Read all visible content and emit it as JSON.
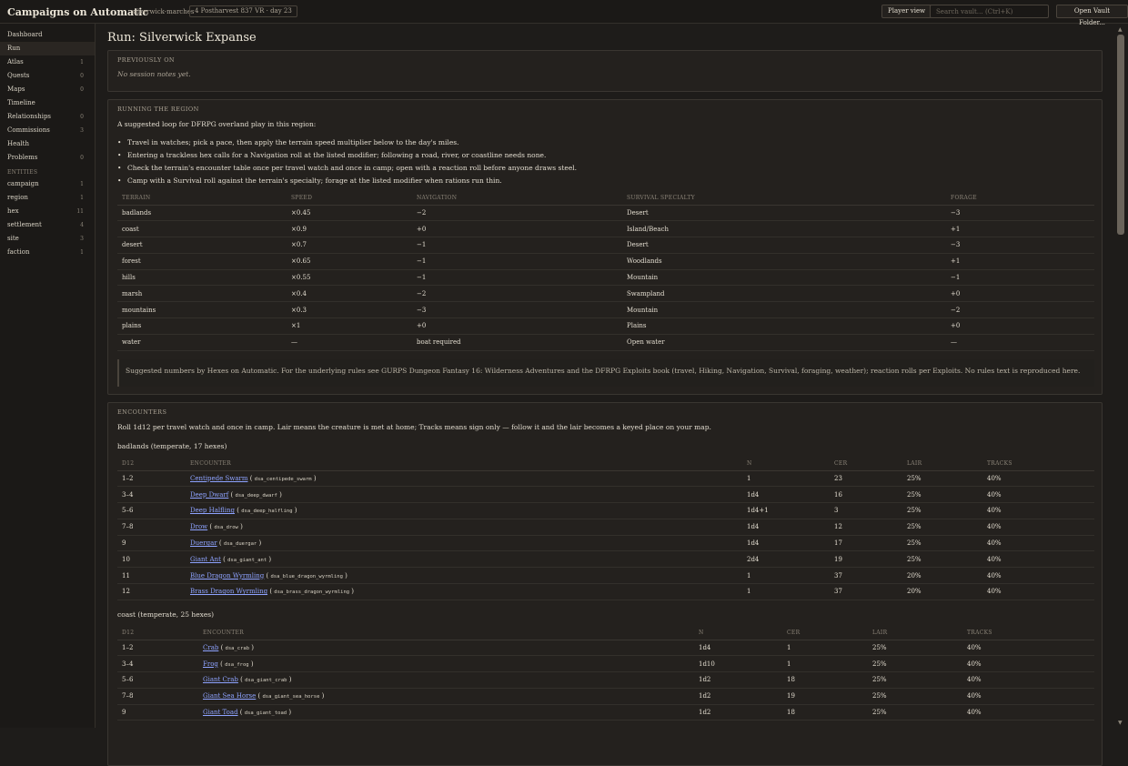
{
  "app": {
    "title": "Campaigns on Automatic",
    "campaign": "silverwick-marches",
    "date": "4 Postharvest 837 VR · day 23",
    "player_view": "Player view",
    "search_placeholder": "Search vault… (Ctrl+K)",
    "open_vault": "Open Vault Folder..."
  },
  "sidebar": {
    "items": [
      {
        "label": "Dashboard",
        "count": ""
      },
      {
        "label": "Run",
        "count": ""
      },
      {
        "label": "Atlas",
        "count": "1"
      },
      {
        "label": "Quests",
        "count": "0"
      },
      {
        "label": "Maps",
        "count": "0"
      },
      {
        "label": "Timeline",
        "count": ""
      },
      {
        "label": "Relationships",
        "count": "0"
      },
      {
        "label": "Commissions",
        "count": "3"
      },
      {
        "label": "Health",
        "count": ""
      },
      {
        "label": "Problems",
        "count": "0"
      }
    ],
    "entities_header": "ENTITIES",
    "entities": [
      {
        "label": "campaign",
        "count": "1"
      },
      {
        "label": "region",
        "count": "1"
      },
      {
        "label": "hex",
        "count": "11"
      },
      {
        "label": "settlement",
        "count": "4"
      },
      {
        "label": "site",
        "count": "3"
      },
      {
        "label": "faction",
        "count": "1"
      }
    ]
  },
  "page": {
    "title": "Run: Silverwick Expanse"
  },
  "previously": {
    "label": "PREVIOUSLY ON",
    "text": "No session notes yet."
  },
  "running": {
    "label": "RUNNING THE REGION",
    "intro": "A suggested loop for DFRPG overland play in this region:",
    "bullets": [
      "Travel in watches; pick a pace, then apply the terrain speed multiplier below to the day's miles.",
      "Entering a trackless hex calls for a Navigation roll at the listed modifier; following a road, river, or coastline needs none.",
      "Check the terrain's encounter table once per travel watch and once in camp; open with a reaction roll before anyone draws steel.",
      "Camp with a Survival roll against the terrain's specialty; forage at the listed modifier when rations run thin."
    ],
    "headers": [
      "TERRAIN",
      "SPEED",
      "NAVIGATION",
      "SURVIVAL SPECIALTY",
      "FORAGE"
    ],
    "rows": [
      [
        "badlands",
        "×0.45",
        "−2",
        "Desert",
        "−3"
      ],
      [
        "coast",
        "×0.9",
        "+0",
        "Island/Beach",
        "+1"
      ],
      [
        "desert",
        "×0.7",
        "−1",
        "Desert",
        "−3"
      ],
      [
        "forest",
        "×0.65",
        "−1",
        "Woodlands",
        "+1"
      ],
      [
        "hills",
        "×0.55",
        "−1",
        "Mountain",
        "−1"
      ],
      [
        "marsh",
        "×0.4",
        "−2",
        "Swampland",
        "+0"
      ],
      [
        "mountains",
        "×0.3",
        "−3",
        "Mountain",
        "−2"
      ],
      [
        "plains",
        "×1",
        "+0",
        "Plains",
        "+0"
      ],
      [
        "water",
        "—",
        "boat required",
        "Open water",
        "—"
      ]
    ],
    "note": "Suggested numbers by Hexes on Automatic. For the underlying rules see GURPS Dungeon Fantasy 16: Wilderness Adventures and the DFRPG Exploits book (travel, Hiking, Navigation, Survival, foraging, weather); reaction rolls per Exploits. No rules text is reproduced here."
  },
  "encounters": {
    "label": "ENCOUNTERS",
    "intro": "Roll 1d12 per travel watch and once in camp. Lair means the creature is met at home; Tracks means sign only — follow it and the lair becomes a keyed place on your map.",
    "headers": [
      "D12",
      "ENCOUNTER",
      "N",
      "CER",
      "LAIR",
      "TRACKS"
    ],
    "tables": [
      {
        "heading": "badlands (temperate, 17 hexes)",
        "rows": [
          {
            "roll": "1–2",
            "name": "Centipede Swarm",
            "id": "dsa_centipede_swarm",
            "n": "1",
            "cer": "23",
            "lair": "25%",
            "tracks": "40%"
          },
          {
            "roll": "3–4",
            "name": "Deep Dwarf",
            "id": "dsa_deep_dwarf",
            "n": "1d4",
            "cer": "16",
            "lair": "25%",
            "tracks": "40%"
          },
          {
            "roll": "5–6",
            "name": "Deep Halfling",
            "id": "dsa_deep_halfling",
            "n": "1d4+1",
            "cer": "3",
            "lair": "25%",
            "tracks": "40%"
          },
          {
            "roll": "7–8",
            "name": "Drow",
            "id": "dsa_drow",
            "n": "1d4",
            "cer": "12",
            "lair": "25%",
            "tracks": "40%"
          },
          {
            "roll": "9",
            "name": "Duergar",
            "id": "dsa_duergar",
            "n": "1d4",
            "cer": "17",
            "lair": "25%",
            "tracks": "40%"
          },
          {
            "roll": "10",
            "name": "Giant Ant",
            "id": "dsa_giant_ant",
            "n": "2d4",
            "cer": "19",
            "lair": "25%",
            "tracks": "40%"
          },
          {
            "roll": "11",
            "name": "Blue Dragon Wyrmling",
            "id": "dsa_blue_dragon_wyrmling",
            "n": "1",
            "cer": "37",
            "lair": "20%",
            "tracks": "40%"
          },
          {
            "roll": "12",
            "name": "Brass Dragon Wyrmling",
            "id": "dsa_brass_dragon_wyrmling",
            "n": "1",
            "cer": "37",
            "lair": "20%",
            "tracks": "40%"
          }
        ]
      },
      {
        "heading": "coast (temperate, 25 hexes)",
        "rows": [
          {
            "roll": "1–2",
            "name": "Crab",
            "id": "dsa_crab",
            "n": "1d4",
            "cer": "1",
            "lair": "25%",
            "tracks": "40%"
          },
          {
            "roll": "3–4",
            "name": "Frog",
            "id": "dsa_frog",
            "n": "1d10",
            "cer": "1",
            "lair": "25%",
            "tracks": "40%"
          },
          {
            "roll": "5–6",
            "name": "Giant Crab",
            "id": "dsa_giant_crab",
            "n": "1d2",
            "cer": "18",
            "lair": "25%",
            "tracks": "40%"
          },
          {
            "roll": "7–8",
            "name": "Giant Sea Horse",
            "id": "dsa_giant_sea_horse",
            "n": "1d2",
            "cer": "19",
            "lair": "25%",
            "tracks": "40%"
          },
          {
            "roll": "9",
            "name": "Giant Toad",
            "id": "dsa_giant_toad",
            "n": "1d2",
            "cer": "18",
            "lair": "25%",
            "tracks": "40%"
          }
        ]
      }
    ]
  }
}
